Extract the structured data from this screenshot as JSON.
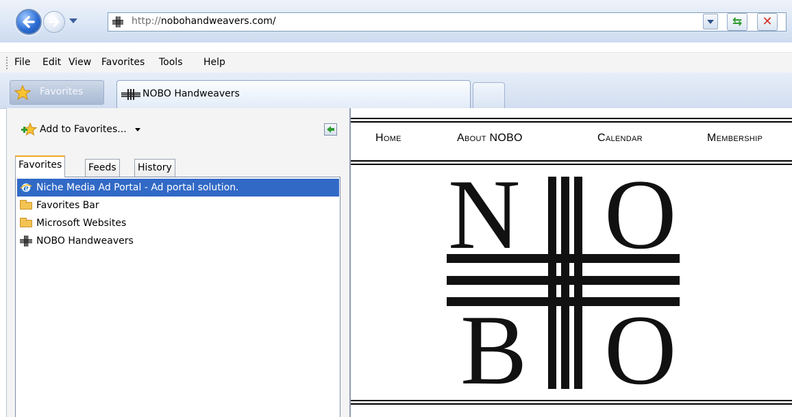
{
  "browser": {
    "address_bar": {
      "scheme": "http://",
      "host": "nobohandweavers.com/"
    },
    "menu": [
      "File",
      "Edit",
      "View",
      "Favorites",
      "Tools",
      "Help"
    ],
    "favorites_button_label": "Favorites",
    "tabs": [
      {
        "title": "NOBO Handweavers",
        "active": true
      }
    ]
  },
  "favorites_center": {
    "add_label": "Add to Favorites...",
    "tabs": [
      "Favorites",
      "Feeds",
      "History"
    ],
    "active_tab": "Favorites",
    "items": [
      {
        "label": "Niche Media Ad Portal - Ad portal solution.",
        "icon": "ie-page-icon",
        "selected": true
      },
      {
        "label": "Favorites Bar",
        "icon": "folder-icon"
      },
      {
        "label": "Microsoft Websites",
        "icon": "folder-icon"
      },
      {
        "label": "NOBO Handweavers",
        "icon": "nobo-favicon"
      }
    ]
  },
  "site": {
    "nav": [
      "Home",
      "About NOBO",
      "Calendar",
      "Membership"
    ],
    "logo_letters": [
      "N",
      "O",
      "B",
      "O"
    ]
  },
  "colors": {
    "selection": "#3169c6",
    "chrome_blue": "#d7e3f4"
  }
}
